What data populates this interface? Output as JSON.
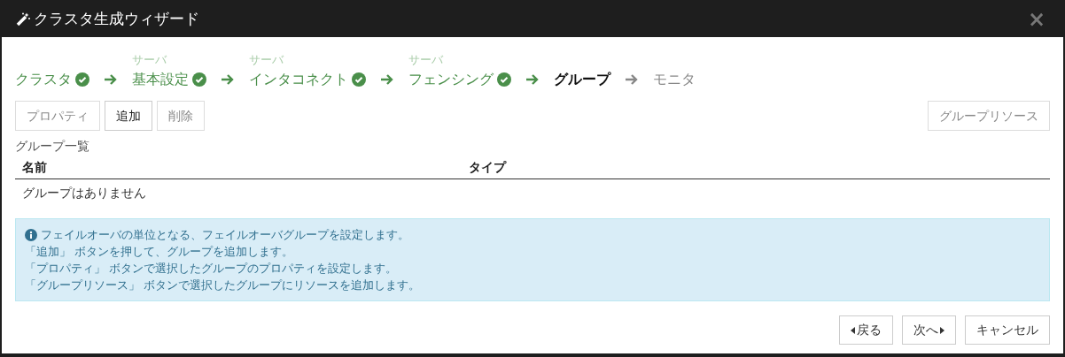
{
  "window": {
    "title": "クラスタ生成ウィザード",
    "close": "×"
  },
  "steps": [
    {
      "label": "クラスタ",
      "completed": true,
      "selected": false
    },
    {
      "sublabel": "サーバ",
      "label": "基本設定",
      "completed": true,
      "selected": false
    },
    {
      "sublabel": "サーバ",
      "label": "インタコネクト",
      "completed": true,
      "selected": false
    },
    {
      "sublabel": "サーバ",
      "label": "フェンシング",
      "completed": true,
      "selected": false
    },
    {
      "label": "グループ",
      "completed": false,
      "selected": true
    },
    {
      "label": "モニタ",
      "completed": false,
      "selected": false
    }
  ],
  "toolbar": [
    {
      "label": "プロパティ",
      "disabled": true
    },
    {
      "label": "追加",
      "disabled": false
    },
    {
      "label": "削除",
      "disabled": true
    }
  ],
  "toolbar_right": {
    "label": "グループリソース",
    "disabled": true
  },
  "list": {
    "title": "グループ一覧",
    "columns": [
      "名前",
      "タイプ"
    ],
    "empty": "グループはありません"
  },
  "info": [
    "フェイルオーバの単位となる、フェイルオーバグループを設定します。",
    "「追加」 ボタンを押して、グループを追加します。",
    "「プロパティ」 ボタンで選択したグループのプロパティを設定します。",
    "「グループリソース」 ボタンで選択したグループにリソースを追加します。"
  ],
  "footer": [
    {
      "label": "戻る",
      "kind": "prev"
    },
    {
      "label": "次へ",
      "kind": "next"
    },
    {
      "label": "キャンセル",
      "kind": "plain"
    }
  ]
}
